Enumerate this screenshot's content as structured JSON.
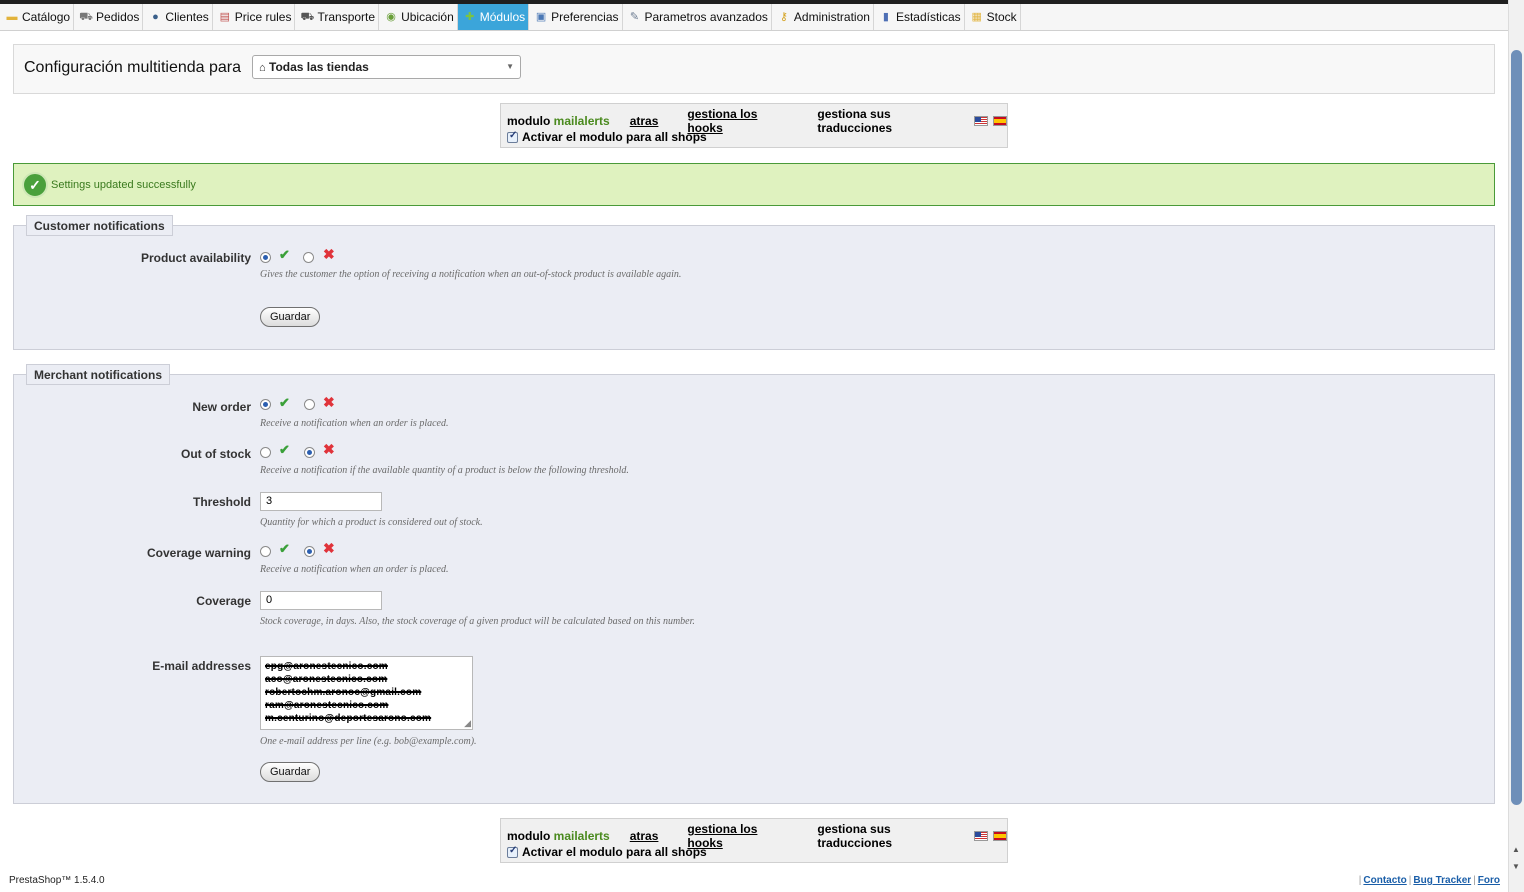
{
  "nav": {
    "tabs": [
      {
        "label": "Catálogo",
        "icon": "folder-icon"
      },
      {
        "label": "Pedidos",
        "icon": "cart-icon"
      },
      {
        "label": "Clientes",
        "icon": "customer-icon"
      },
      {
        "label": "Price rules",
        "icon": "price-rules-icon"
      },
      {
        "label": "Transporte",
        "icon": "truck-icon"
      },
      {
        "label": "Ubicación",
        "icon": "globe-icon"
      },
      {
        "label": "Módulos",
        "icon": "puzzle-icon",
        "active": true
      },
      {
        "label": "Preferencias",
        "icon": "preferences-icon"
      },
      {
        "label": "Parametros avanzados",
        "icon": "wrench-icon"
      },
      {
        "label": "Administration",
        "icon": "key-icon"
      },
      {
        "label": "Estadísticas",
        "icon": "stats-icon"
      },
      {
        "label": "Stock",
        "icon": "stock-icon"
      }
    ],
    "active_color": "#3ba5da"
  },
  "multistore": {
    "title": "Configuración multitienda para",
    "selected_shop": "Todas las tiendas"
  },
  "module_bar": {
    "module_word": "modulo",
    "module_name": "mailalerts",
    "back": "atras",
    "hooks": "gestiona los hooks",
    "translations": "gestiona sus traducciones",
    "activate_label": "Activar el modulo para all shops"
  },
  "success": {
    "message": "Settings updated successfully",
    "color": "#dff2bf"
  },
  "customer_notifications": {
    "legend": "Customer notifications",
    "product_availability": {
      "label": "Product availability",
      "value": "yes",
      "hint": "Gives the customer the option of receiving a notification when an out-of-stock product is available again."
    },
    "save": "Guardar"
  },
  "merchant_notifications": {
    "legend": "Merchant notifications",
    "new_order": {
      "label": "New order",
      "value": "yes",
      "hint": "Receive a notification when an order is placed."
    },
    "out_of_stock": {
      "label": "Out of stock",
      "value": "no",
      "hint": "Receive a notification if the available quantity of a product is below the following threshold."
    },
    "threshold": {
      "label": "Threshold",
      "value": "3",
      "hint": "Quantity for which a product is considered out of stock."
    },
    "coverage_warning": {
      "label": "Coverage warning",
      "value": "no",
      "hint": "Receive a notification when an order is placed."
    },
    "coverage": {
      "label": "Coverage",
      "value": "0",
      "hint": "Stock coverage, in days. Also, the stock coverage of a given product will be calculated based on this number."
    },
    "emails": {
      "label": "E-mail addresses",
      "lines": [
        "epg@aronestecnico.com",
        "aco@aronestecnico.com",
        "robertochm.aronoc@gmail.com",
        "ram@aronestecnico.com",
        "m.centurino@deportesarono.com"
      ],
      "hint": "One e-mail address per line (e.g. bob@example.com)."
    },
    "save": "Guardar"
  },
  "footer": {
    "version": "PrestaShop™ 1.5.4.0",
    "links": [
      "Contacto",
      "Bug Tracker",
      "Foro"
    ]
  }
}
